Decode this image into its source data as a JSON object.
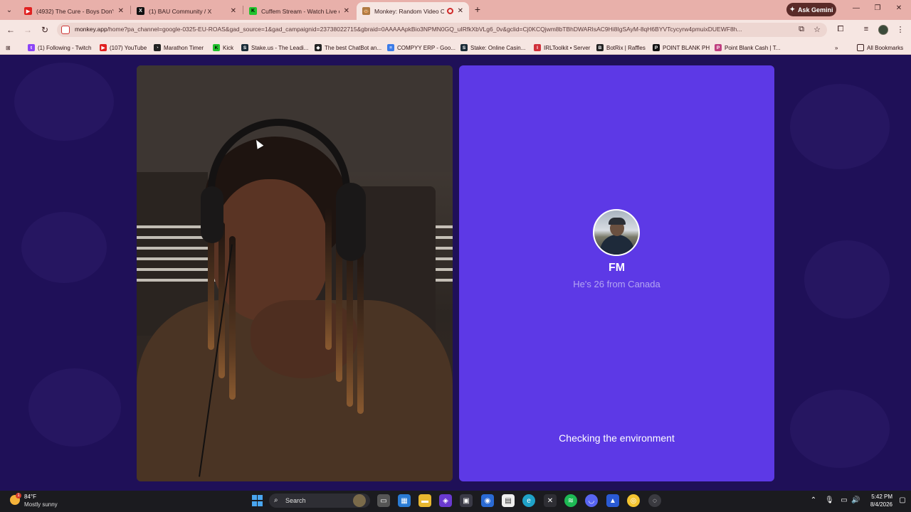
{
  "browser": {
    "tabs": [
      {
        "label": "(4932) The Cure - Boys Don't C",
        "icon": "youtube-icon",
        "color": "#e02020"
      },
      {
        "label": "(1) BAU Community / X",
        "icon": "x-icon",
        "color": "#111111"
      },
      {
        "label": "Cuffem Stream - Watch Live on",
        "icon": "kick-icon",
        "color": "#22c32e"
      },
      {
        "label": "Monkey: Random Video Ch",
        "icon": "monkey-icon",
        "color": "#b07a40",
        "active": true
      }
    ],
    "ask_gemini": "Ask Gemini",
    "url_host": "monkey.app",
    "url_path": "/home?pa_channel=google-0325-EU-ROAS&gad_source=1&gad_campaignid=23738022715&gbraid=0AAAAApkBio3NPMN0GQ_uIRfkXbVLg6_0v&gclid=Cj0KCQjwm8bTBhDWARIsAC9Hi8IgSAyM-8qH6BYVTcycyrw4pmuixDUEWF8h...",
    "bookmarks": [
      {
        "label": "(1) Following - Twitch",
        "icon": "twitch-icon",
        "color": "#8c45f7"
      },
      {
        "label": "(107) YouTube",
        "icon": "youtube-icon",
        "color": "#e02020"
      },
      {
        "label": "Marathon Timer",
        "icon": "timer-icon",
        "color": "#222222"
      },
      {
        "label": "Kick",
        "icon": "kick-icon",
        "color": "#22c32e"
      },
      {
        "label": "Stake.us - The Leadi...",
        "icon": "stake-icon",
        "color": "#1a2c38"
      },
      {
        "label": "The best ChatBot an...",
        "icon": "chatbot-icon",
        "color": "#222222"
      },
      {
        "label": "COMPYY ERP - Goo...",
        "icon": "docs-icon",
        "color": "#3b7be8"
      },
      {
        "label": "Stake: Online Casin...",
        "icon": "stake-icon",
        "color": "#1a2c38"
      },
      {
        "label": "IRLToolkit • Server",
        "icon": "irltoolkit-icon",
        "color": "#d0303a"
      },
      {
        "label": "BotRix | Raffles",
        "icon": "botrix-icon",
        "color": "#222222"
      },
      {
        "label": "POINT BLANK PH",
        "icon": "pointblank-icon",
        "color": "#111111"
      },
      {
        "label": "Point Blank Cash | T...",
        "icon": "pointblank-cash-icon",
        "color": "#c04080"
      }
    ],
    "all_bookmarks": "All Bookmarks"
  },
  "monkey": {
    "partner": {
      "name": "FM",
      "info": "He's 26 from Canada"
    },
    "status": "Checking the environment"
  },
  "taskbar": {
    "weather_temp": "84°F",
    "weather_desc": "Mostly sunny",
    "weather_badge": "1",
    "search_label": "Search",
    "time": "5:42 PM",
    "date": "8/4/2026"
  },
  "colors": {
    "page_bg": "#1f1058",
    "partner_panel": "#5d39e6",
    "chrome_frame": "#e8b0aa"
  }
}
